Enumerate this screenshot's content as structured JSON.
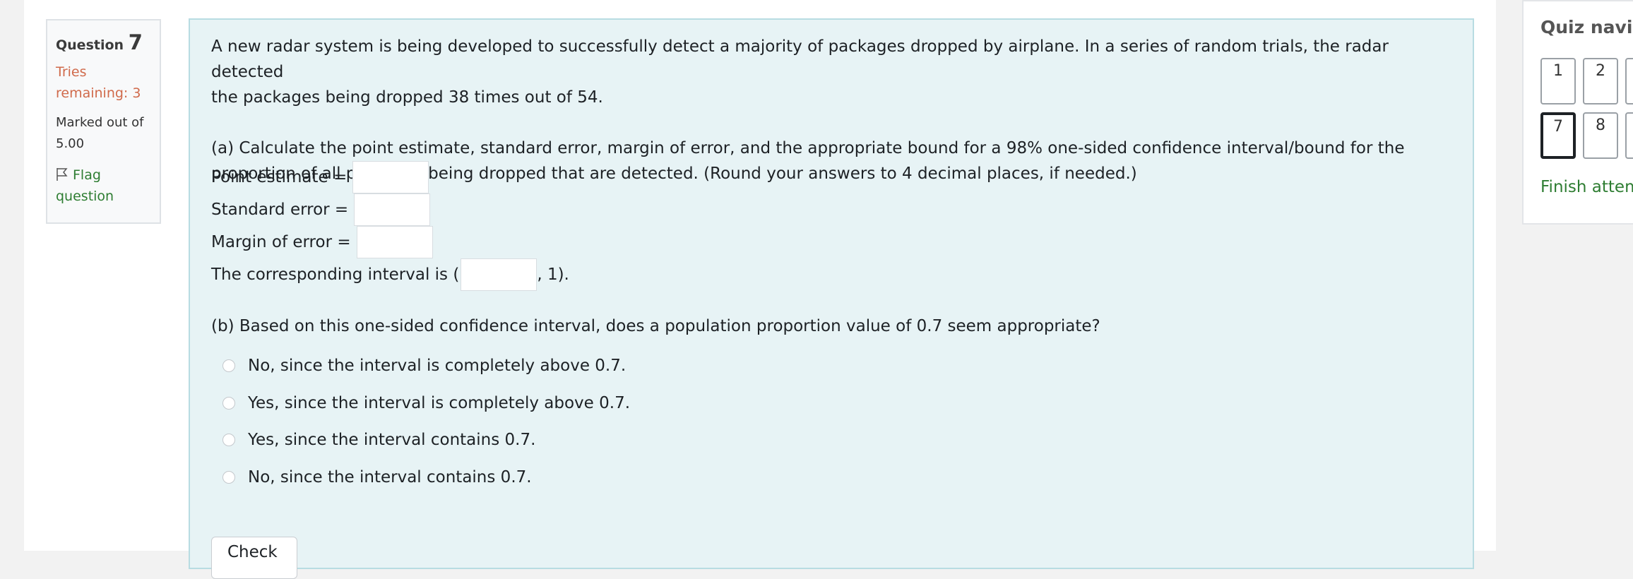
{
  "question_info": {
    "label": "Question",
    "number": "7",
    "tries_line1": "Tries",
    "tries_line2": "remaining: 3",
    "marked_line1": "Marked out of",
    "marked_line2": "5.00",
    "flag_line1": "Flag",
    "flag_line2": "question"
  },
  "question": {
    "intro_line1": "A new radar system is being developed to successfully detect a majority of packages dropped by airplane. In a series of random trials, the radar detected",
    "intro_line2": "the packages being dropped 38 times out of 54.",
    "part_a_line1": "(a) Calculate the point estimate, standard error, margin of error, and the appropriate bound for a 98% one-sided confidence interval/bound for the",
    "part_a_line2": "proportion of all packages being dropped that are detected. (Round your answers to 4 decimal places, if needed.)",
    "point_estimate_label": "Point estimate =",
    "point_estimate_value": "",
    "standard_error_label": "Standard error =",
    "standard_error_value": "",
    "margin_error_label": "Margin of error =",
    "margin_error_value": "",
    "interval_prefix": "The corresponding interval is (",
    "interval_value": "",
    "interval_suffix": ", 1).",
    "part_b": "(b) Based on this one-sided confidence interval, does a population proportion value of 0.7 seem appropriate?",
    "options": [
      "No, since the interval is completely above 0.7.",
      "Yes, since the interval is completely above 0.7.",
      "Yes, since the interval contains 0.7.",
      "No, since the interval contains 0.7."
    ],
    "check_button": "Check"
  },
  "quiz_nav": {
    "title": "Quiz navigation",
    "buttons": [
      "1",
      "2",
      "7",
      "8"
    ],
    "current": "7",
    "finish": "Finish attempt ..."
  }
}
